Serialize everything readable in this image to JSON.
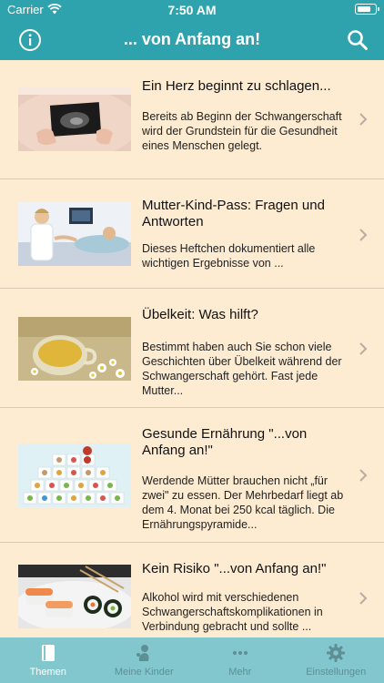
{
  "status": {
    "carrier": "Carrier",
    "time": "7:50 AM"
  },
  "nav": {
    "title": "... von Anfang an!"
  },
  "articles": [
    {
      "title": "Ein Herz beginnt zu schlagen...",
      "desc": "Bereits ab Beginn der Schwangerschaft wird der Grundstein für die Gesundheit eines Menschen gelegt."
    },
    {
      "title": "Mutter-Kind-Pass: Fragen und Antworten",
      "desc": "Dieses Heftchen dokumentiert alle wichtigen Ergebnisse von ..."
    },
    {
      "title": "Übelkeit: Was hilft?",
      "desc": "Bestimmt haben auch Sie schon viele Geschichten über Übelkeit während der Schwangerschaft gehört. Fast jede Mutter..."
    },
    {
      "title": "Gesunde Ernährung \"...von Anfang an!\"",
      "desc": "Werdende Mütter brauchen nicht „für zwei\" zu essen. Der Mehrbedarf liegt ab dem 4. Monat bei 250 kcal täglich. Die Ernährungspyramide..."
    },
    {
      "title": "Kein Risiko \"...von Anfang an!\"",
      "desc": "Alkohol wird mit verschiedenen Schwangerschaftskomplikationen in Verbindung gebracht und sollte ..."
    }
  ],
  "tabs": [
    {
      "label": "Themen",
      "icon": "book-icon",
      "active": true
    },
    {
      "label": "Meine Kinder",
      "icon": "baby-icon",
      "active": false
    },
    {
      "label": "Mehr",
      "icon": "more-icon",
      "active": false
    },
    {
      "label": "Einstellungen",
      "icon": "gear-icon",
      "active": false
    }
  ],
  "colors": {
    "header": "#2fa3ad",
    "background": "#fdebd2",
    "tabbar": "#82c7ce"
  }
}
